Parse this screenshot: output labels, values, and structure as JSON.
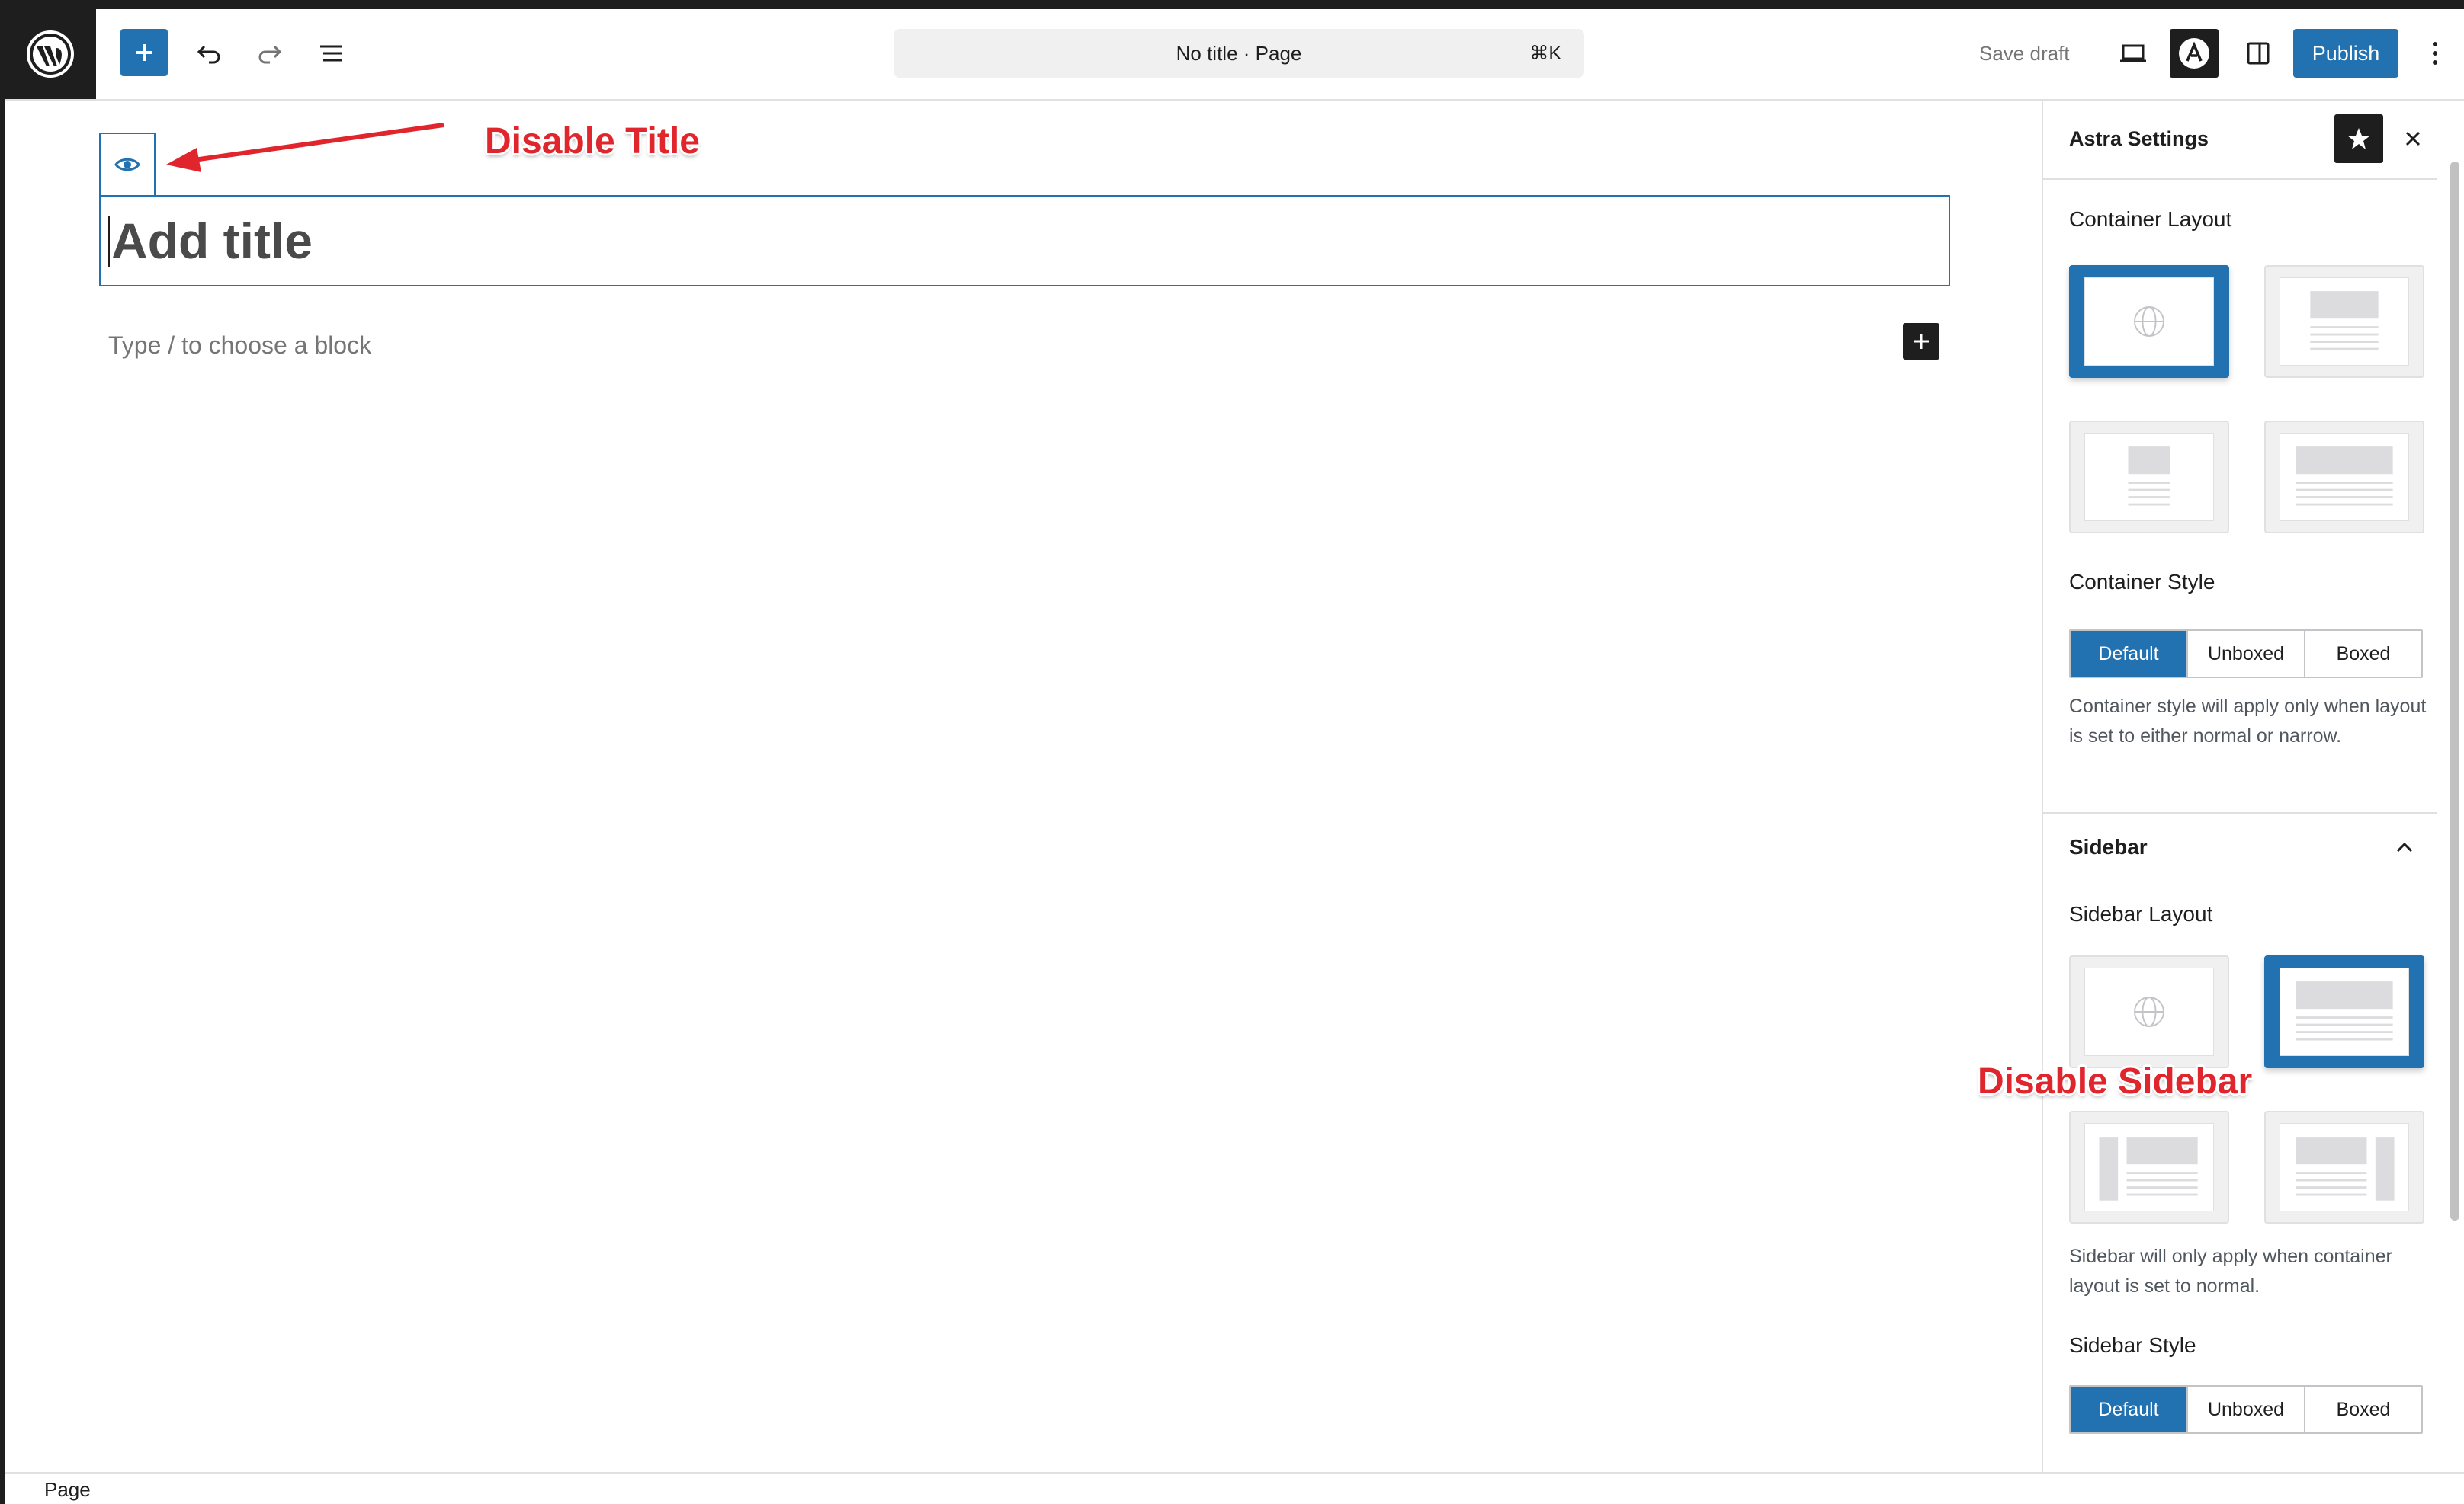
{
  "topbar": {
    "document_title": "No title · Page",
    "shortcut": "⌘K",
    "save_draft_label": "Save draft",
    "publish_label": "Publish",
    "icons": [
      "wordpress-logo",
      "plus-icon",
      "undo-icon",
      "redo-icon",
      "list-view-icon",
      "desktop-preview-icon",
      "astra-icon",
      "settings-panel-icon",
      "more-options-icon"
    ]
  },
  "editor": {
    "title_placeholder": "Add title",
    "block_placeholder": "Type / to choose a block"
  },
  "annotations": {
    "disable_title": "Disable Title",
    "disable_sidebar": "Disable Sidebar",
    "color": "#e0252d"
  },
  "settings": {
    "panel_title": "Astra Settings",
    "container_layout_label": "Container Layout",
    "container_style_label": "Container Style",
    "container_style_options": [
      "Default",
      "Unboxed",
      "Boxed"
    ],
    "container_style_selected": "Default",
    "container_style_help": "Container style will apply only when layout is set to either normal or narrow.",
    "sidebar_section_label": "Sidebar",
    "sidebar_layout_label": "Sidebar Layout",
    "sidebar_help": "Sidebar will only apply when container layout is set to normal.",
    "sidebar_style_label": "Sidebar Style",
    "sidebar_style_options": [
      "Default",
      "Unboxed",
      "Boxed"
    ],
    "sidebar_style_selected": "Default"
  },
  "statusbar": {
    "label": "Page"
  },
  "colors": {
    "accent": "#2271b1",
    "dark": "#1e1e1e",
    "annotation": "#e0252d"
  }
}
